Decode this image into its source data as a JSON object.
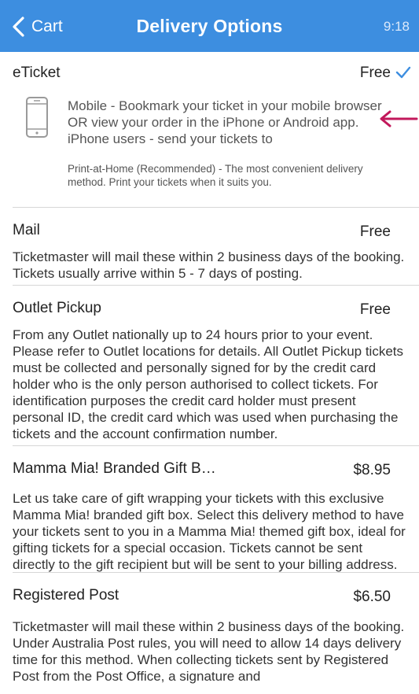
{
  "navbar": {
    "back_label": "Cart",
    "title": "Delivery Options",
    "time": "9:18"
  },
  "options": [
    {
      "title": "eTicket",
      "price": "Free",
      "selected": true,
      "sub_options": [
        {
          "icon": "mobile-phone-icon",
          "text": "Mobile - Bookmark your ticket in your mobile browser OR view your order in the iPhone or Android app. iPhone users - send your tickets to"
        },
        {
          "text": "Print-at-Home (Recommended) - The most convenient delivery method.  Print your tickets when it suits you."
        }
      ]
    },
    {
      "title": "Mail",
      "price": "Free",
      "description": "Ticketmaster will mail these within 2 business days of the booking. Tickets usually arrive within 5 - 7 days of posting."
    },
    {
      "title": "Outlet Pickup",
      "price": "Free",
      "description": "From any Outlet nationally up to 24 hours prior to your event. Please refer to Outlet locations for details. All Outlet Pickup tickets must be collected and personally signed for by the credit card holder who is the only person authorised to collect tickets. For identification purposes the credit card holder must present personal ID, the credit card which was used when purchasing the tickets and the account confirmation number."
    },
    {
      "title": "Mamma Mia! Branded Gift B…",
      "price": "$8.95",
      "description": "Let us take care of gift wrapping your tickets with this exclusive Mamma Mia! branded gift box. Select this delivery method to have your tickets sent to you in a Mamma Mia! themed gift box, ideal for gifting tickets for a special occasion. Tickets cannot be sent directly to the gift recipient but will be sent to your billing address."
    },
    {
      "title": "Registered Post",
      "price": "$6.50",
      "description": "Ticketmaster will mail these within 2 business days of the booking. Under Australia Post rules, you will need to allow 14 days delivery time for this method. When collecting tickets sent by Registered Post from the Post Office, a signature and"
    }
  ],
  "colors": {
    "navbar": "#3d8ee0",
    "check": "#3d8ee0",
    "annotation_arrow": "#c2185b"
  }
}
